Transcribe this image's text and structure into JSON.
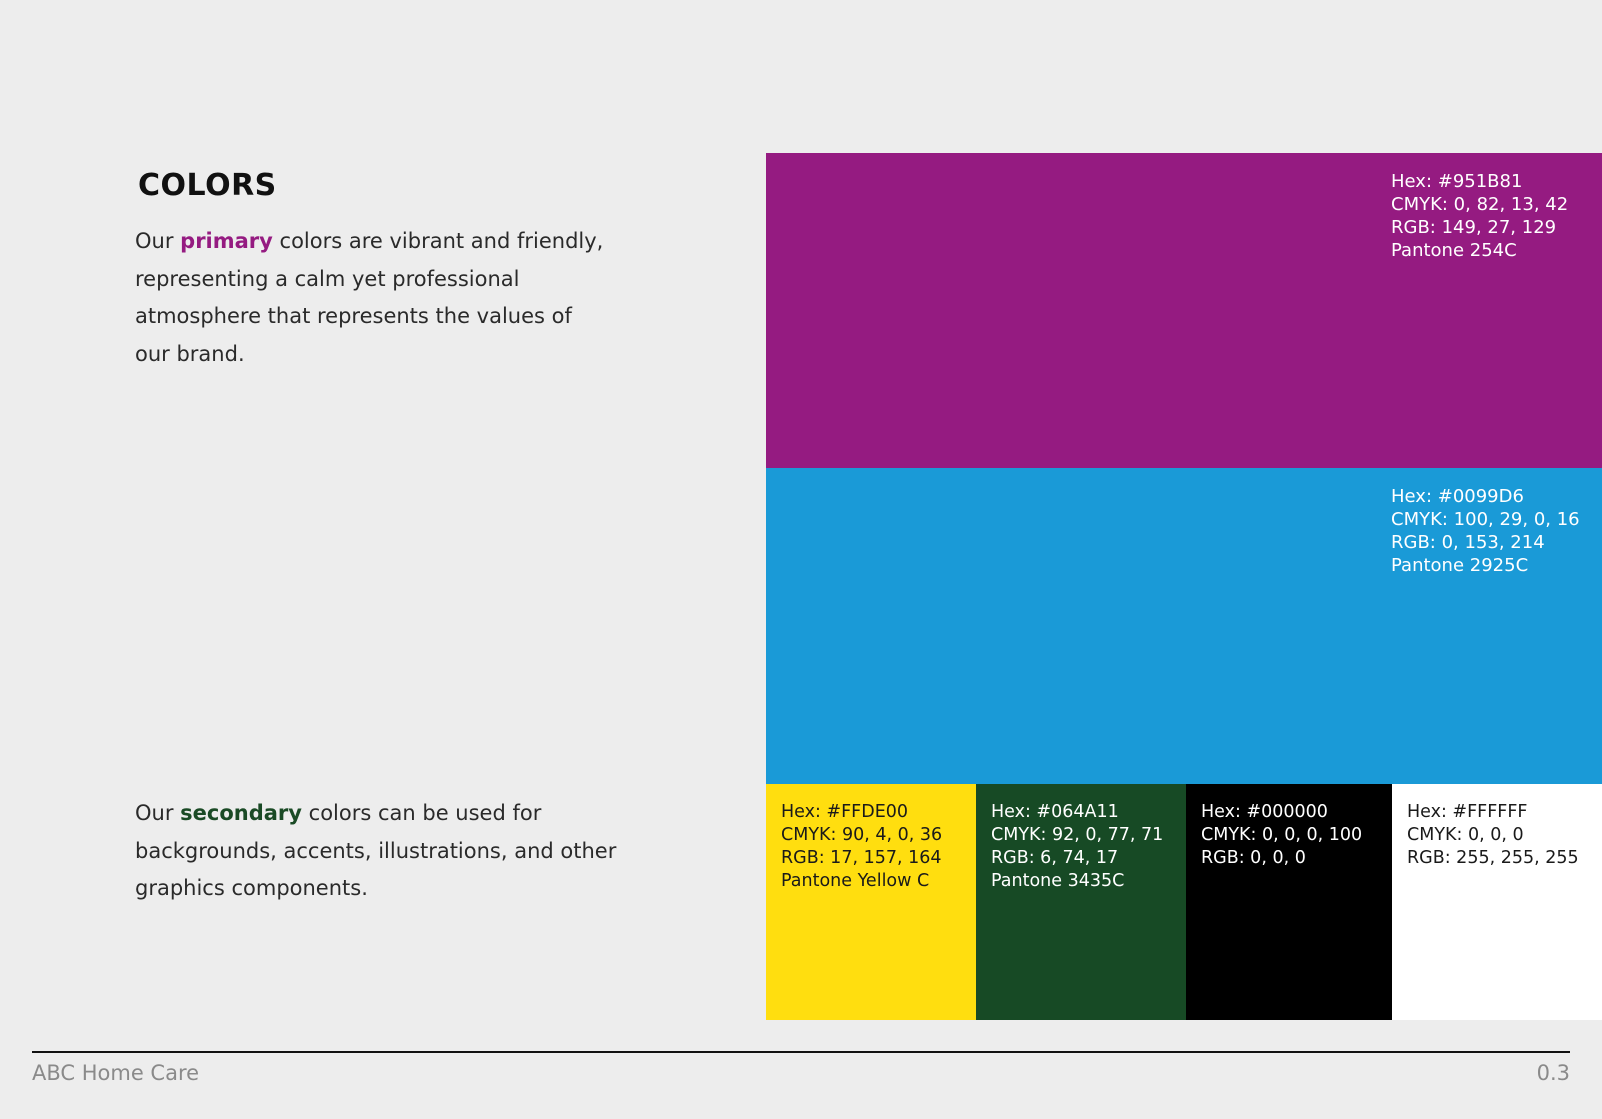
{
  "page": {
    "title": "COLORS"
  },
  "intro_primary": {
    "prefix": "Our ",
    "highlight": "primary",
    "suffix": " colors are vibrant and friendly, representing a calm yet professional atmosphere that represents the values of our brand.",
    "highlight_color": "#951B81"
  },
  "intro_secondary": {
    "prefix": "Our ",
    "highlight": "secondary",
    "suffix": " colors can be used for backgrounds, accents, illustrations, and other graphics components.",
    "highlight_color": "#1A4A25"
  },
  "primary_colors": [
    {
      "swatch": "#951B81",
      "text_color": "#FFFFFF",
      "hex": "Hex: #951B81",
      "cmyk": "CMYK: 0, 82, 13, 42",
      "rgb": "RGB: 149, 27, 129",
      "pantone": "Pantone 254C"
    },
    {
      "swatch": "#1A9AD7",
      "text_color": "#FFFFFF",
      "hex": "Hex: #0099D6",
      "cmyk": "CMYK: 100, 29, 0, 16",
      "rgb": "RGB: 0, 153, 214",
      "pantone": "Pantone 2925C"
    }
  ],
  "secondary_colors": [
    {
      "swatch": "#FFDE0F",
      "text_color": "#1a1a1a",
      "hex": "Hex: #FFDE00",
      "cmyk": "CMYK: 90, 4, 0, 36",
      "rgb": "RGB: 17, 157, 164",
      "pantone": "Pantone Yellow C"
    },
    {
      "swatch": "#174A25",
      "text_color": "#FFFFFF",
      "hex": "Hex: #064A11",
      "cmyk": "CMYK: 92, 0, 77, 71",
      "rgb": "RGB: 6, 74, 17",
      "pantone": "Pantone 3435C"
    },
    {
      "swatch": "#000000",
      "text_color": "#FFFFFF",
      "hex": "Hex: #000000",
      "cmyk": "CMYK: 0, 0, 0, 100",
      "rgb": "RGB: 0, 0, 0"
    },
    {
      "swatch": "#FFFFFF",
      "text_color": "#1a1a1a",
      "hex": "Hex: #FFFFFF",
      "cmyk": "CMYK: 0, 0, 0",
      "rgb": "RGB: 255, 255, 255"
    }
  ],
  "footer": {
    "brand": "ABC Home Care",
    "page_number": "0.3"
  }
}
